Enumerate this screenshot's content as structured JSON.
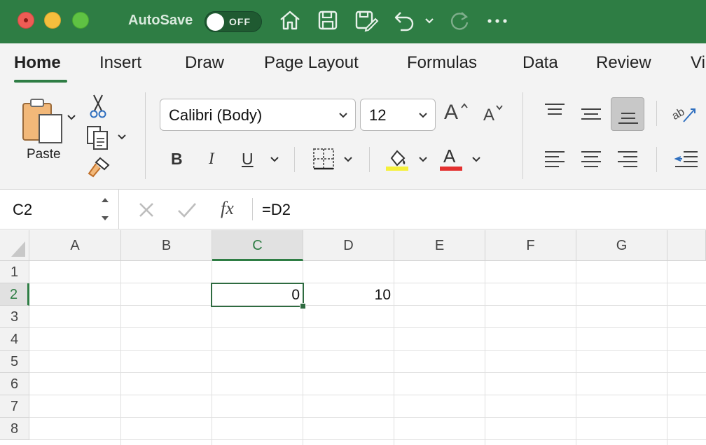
{
  "titlebar": {
    "autosave_label": "AutoSave",
    "autosave_state": "OFF",
    "colors": {
      "background": "#2e7d44"
    }
  },
  "ribbon_tabs": [
    {
      "label": "Home",
      "active": true
    },
    {
      "label": "Insert"
    },
    {
      "label": "Draw"
    },
    {
      "label": "Page Layout"
    },
    {
      "label": "Formulas"
    },
    {
      "label": "Data"
    },
    {
      "label": "Review"
    },
    {
      "label": "Vi"
    }
  ],
  "ribbon": {
    "paste_label": "Paste",
    "font_name": "Calibri (Body)",
    "font_size": "12",
    "grow_font_label": "A",
    "shrink_font_label": "A",
    "bold_label": "B",
    "italic_label": "I",
    "underline_label": "U",
    "font_color_label": "A",
    "highlight_color": "#f5f03a",
    "font_color": "#e3302f"
  },
  "formula_bar": {
    "name_box": "C2",
    "fx_label": "fx",
    "formula": "=D2"
  },
  "sheet": {
    "columns": [
      "A",
      "B",
      "C",
      "D",
      "E",
      "F",
      "G"
    ],
    "rows": [
      "1",
      "2",
      "3",
      "4",
      "5",
      "6",
      "7",
      "8"
    ],
    "selected_column": "C",
    "selected_row": "2",
    "cells": {
      "C2": "0",
      "D2": "10"
    }
  }
}
